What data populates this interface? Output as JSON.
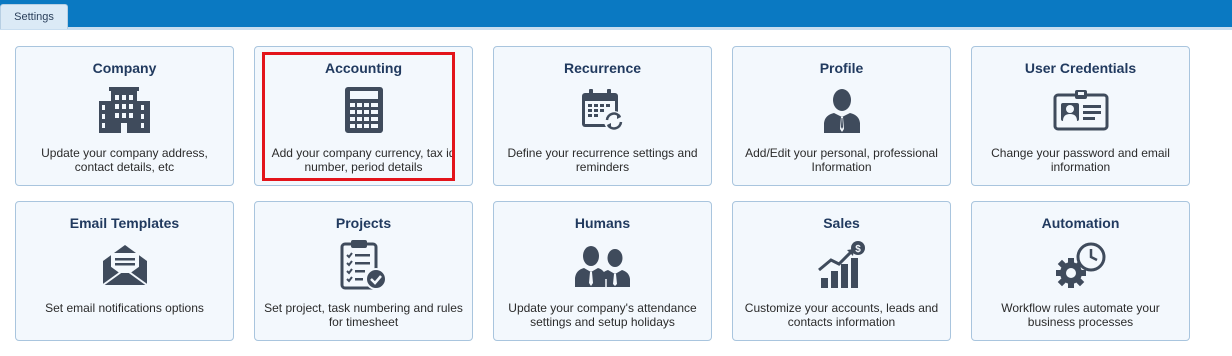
{
  "tabs": [
    {
      "label": "Settings"
    }
  ],
  "cards": [
    {
      "title": "Company",
      "description": "Update your company address, contact details, etc",
      "icon": "building-icon"
    },
    {
      "title": "Accounting",
      "description": "Add your company currency, tax id number, period details",
      "icon": "calculator-icon"
    },
    {
      "title": "Recurrence",
      "description": "Define your recurrence settings and reminders",
      "icon": "calendar-recurrence-icon"
    },
    {
      "title": "Profile",
      "description": "Add/Edit your personal, professional Information",
      "icon": "user-profile-icon"
    },
    {
      "title": "User Credentials",
      "description": "Change your password and email information",
      "icon": "id-card-icon"
    },
    {
      "title": "Email Templates",
      "description": "Set email notifications options",
      "icon": "envelope-icon"
    },
    {
      "title": "Projects",
      "description": "Set project, task numbering and rules for timesheet",
      "icon": "clipboard-checklist-icon"
    },
    {
      "title": "Humans",
      "description": "Update your company's attendance settings and setup holidays",
      "icon": "people-icon"
    },
    {
      "title": "Sales",
      "description": "Customize your accounts, leads and contacts information",
      "icon": "sales-growth-icon"
    },
    {
      "title": "Automation",
      "description": "Workflow rules automate your business processes",
      "icon": "gear-clock-icon"
    }
  ],
  "colors": {
    "topbar": "#0a79c2",
    "card_bg": "#f3f8fd",
    "card_border": "#a9c5de",
    "icon": "#3f4b5c",
    "highlight": "#e3141b"
  }
}
